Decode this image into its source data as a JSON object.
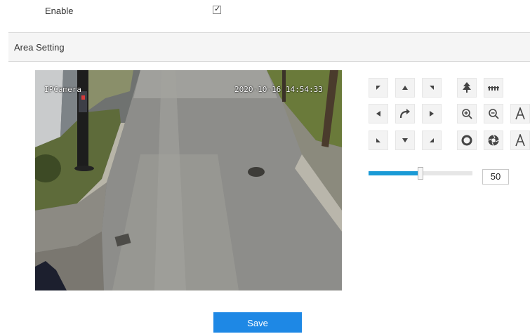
{
  "enable": {
    "label": "Enable",
    "checked": true
  },
  "area_setting": {
    "title": "Area Setting"
  },
  "video": {
    "camera_name": "IPCamera",
    "timestamp": "2020-10-16 14:54:33"
  },
  "ptz": {
    "speed": {
      "value": "50",
      "fraction": 0.5
    }
  },
  "save": {
    "label": "Save"
  },
  "colors": {
    "accent": "#1e88e5",
    "slider_fill": "#1a9ad6"
  }
}
